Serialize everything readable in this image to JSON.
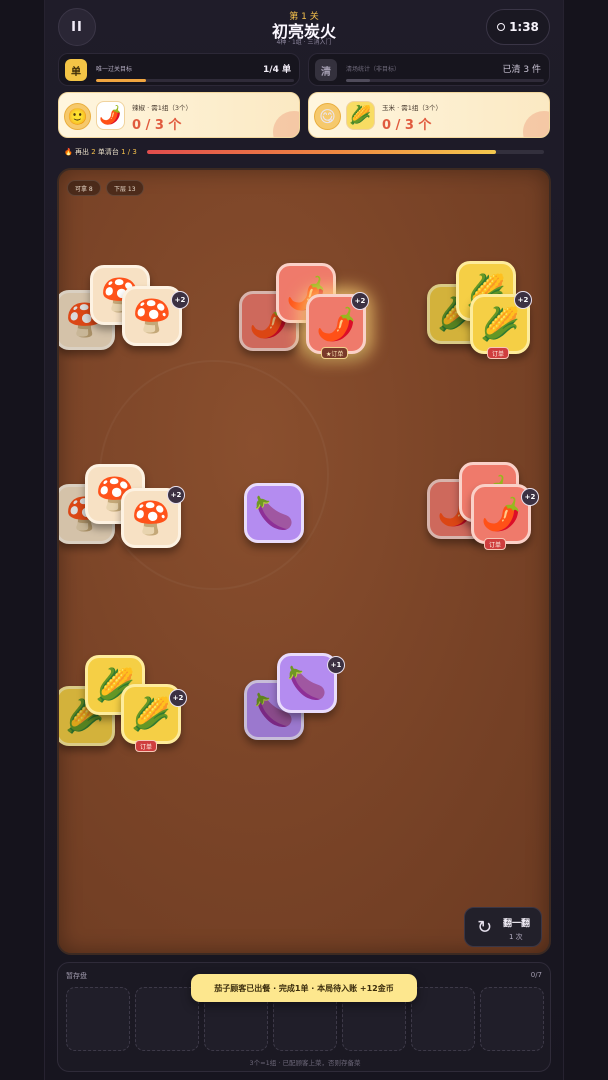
{
  "header": {
    "level_num": "第 1 关",
    "title": "初亮炭火",
    "subtitle": "4种 · 1组 · 三消入门",
    "pause_symbol": "II",
    "timer": "1:38"
  },
  "goals": {
    "main": {
      "badge": "单",
      "label": "唯一过关目标",
      "count": "1/4 单",
      "progress": 0.25
    },
    "secondary": {
      "badge": "清",
      "label": "清场统计（非目标）",
      "count": "已清 3 件",
      "progress": 0.12
    }
  },
  "orders": [
    {
      "face": "🙂",
      "item_icon": "🌶️",
      "title": "辣椒 · 需1组（3个）",
      "progress": "0 / 3 个"
    },
    {
      "face": "😋",
      "item_icon": "🌽",
      "title": "玉米 · 需1组（3个）",
      "progress": "0 / 3 个"
    }
  ],
  "streak": {
    "prefix": "🔥 再出",
    "highlight": "2",
    "suffix": "单清台",
    "count": "1 / 3",
    "progress": 0.88
  },
  "board": {
    "pill_available": "可拿 8",
    "pill_below": "下层 13",
    "stacks": [
      {
        "item": "mushroom",
        "icon": "🍄",
        "extra": "+2",
        "tag": ""
      },
      {
        "item": "pepper",
        "icon": "🌶️",
        "extra": "+2",
        "tag": "★订单"
      },
      {
        "item": "corn",
        "icon": "🌽",
        "extra": "+2",
        "tag": "订单"
      },
      {
        "item": "mushroom",
        "icon": "🍄",
        "extra": "+2",
        "tag": ""
      },
      {
        "item": "eggplant",
        "icon": "🍆",
        "extra": "",
        "tag": ""
      },
      {
        "item": "pepper",
        "icon": "🌶️",
        "extra": "+2",
        "tag": "订单"
      },
      {
        "item": "corn",
        "icon": "🌽",
        "extra": "+2",
        "tag": "订单"
      },
      {
        "item": "eggplant",
        "icon": "🍆",
        "extra": "+1",
        "tag": ""
      }
    ]
  },
  "shuffle": {
    "icon": "↻",
    "label": "翻一翻",
    "count": "1 次"
  },
  "tray": {
    "label": "暂存盘",
    "count": "0/7",
    "slots": 7,
    "hint": "3个=1组 · 已配顾客上菜，否则存备菜"
  },
  "toast": "茄子顾客已出餐 · 完成1单 · 本局待入账 +12金币",
  "colors": {
    "accent": "#f4c04c",
    "board": "#7c4528",
    "order_progress": "#e05a3e",
    "order_tag": "#cf3e3e",
    "toast_bg": "#fde78e"
  }
}
